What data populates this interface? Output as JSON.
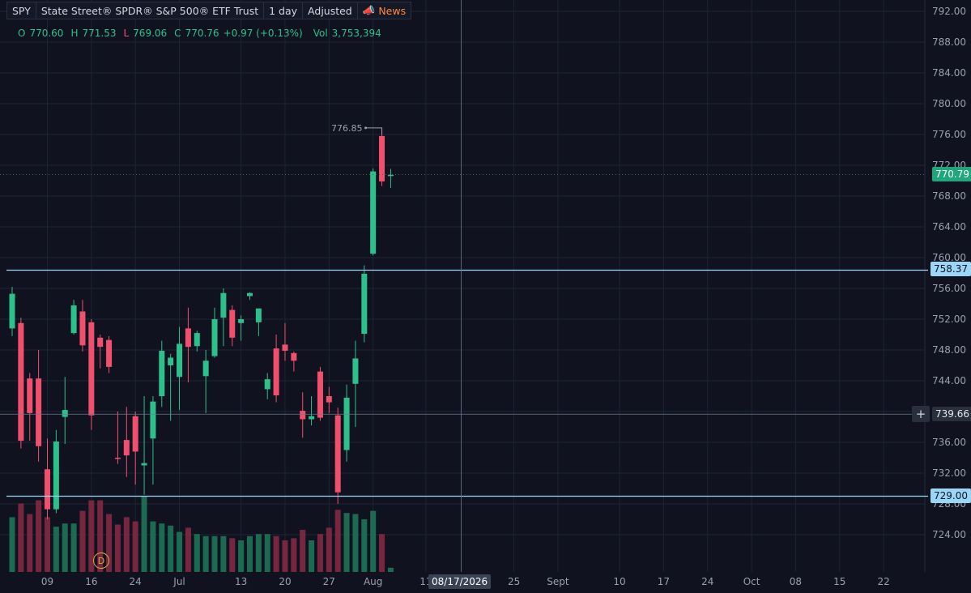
{
  "header": {
    "symbol": "SPY",
    "name": "State Street® SPDR® S&P 500® ETF Trust",
    "interval": "1 day",
    "adjusted": "Adjusted",
    "news": "News"
  },
  "ohlc": {
    "o_label": "O",
    "o": "770.60",
    "h_label": "H",
    "h": "771.53",
    "l_label": "L",
    "l": "769.06",
    "c_label": "C",
    "c": "770.76",
    "change": "+0.97 (+0.13%)",
    "vol_label": "Vol",
    "vol": "3,753,394"
  },
  "badges": {
    "current": "770.79",
    "level1": "758.37",
    "crosshair": "739.66",
    "level2": "729.00"
  },
  "high_marker": "776.85",
  "crosshair_date": "08/17/2026",
  "event_marker": "D",
  "colors": {
    "up": "#2ec08b",
    "down": "#f0506e",
    "level": "#9ad6f5",
    "background": "#10131f"
  },
  "chart_data": {
    "type": "candlestick",
    "y_ticks": [
      "792.00",
      "788.00",
      "784.00",
      "780.00",
      "776.00",
      "772.00",
      "768.00",
      "764.00",
      "760.00",
      "756.00",
      "752.00",
      "748.00",
      "744.00",
      "740.00",
      "736.00",
      "732.00",
      "728.00",
      "724.00"
    ],
    "x_ticks": [
      {
        "label": "09",
        "i": 4
      },
      {
        "label": "16",
        "i": 9
      },
      {
        "label": "24",
        "i": 14
      },
      {
        "label": "Jul",
        "i": 19
      },
      {
        "label": "13",
        "i": 26
      },
      {
        "label": "20",
        "i": 31
      },
      {
        "label": "27",
        "i": 36
      },
      {
        "label": "Aug",
        "i": 41
      },
      {
        "label": "11",
        "i": 47
      },
      {
        "label": "25",
        "i": 57
      },
      {
        "label": "Sept",
        "i": 62
      },
      {
        "label": "10",
        "i": 69
      },
      {
        "label": "17",
        "i": 74
      },
      {
        "label": "24",
        "i": 79
      },
      {
        "label": "Oct",
        "i": 84
      },
      {
        "label": "08",
        "i": 89
      },
      {
        "label": "15",
        "i": 94
      },
      {
        "label": "22",
        "i": 99
      }
    ],
    "ylim": [
      721.0,
      793.0
    ],
    "crosshair": {
      "i": 51,
      "y": 739.66
    },
    "levels": [
      758.37,
      729.0
    ],
    "candles": [
      {
        "o": 750.8,
        "h": 756.2,
        "l": 749.8,
        "c": 755.3,
        "v": 0.52
      },
      {
        "o": 751.5,
        "h": 752.2,
        "l": 735.2,
        "c": 736.2,
        "v": 0.65
      },
      {
        "o": 744.3,
        "h": 745.0,
        "l": 736.2,
        "c": 739.8,
        "v": 0.55
      },
      {
        "o": 744.3,
        "h": 748.0,
        "l": 733.5,
        "c": 735.5,
        "v": 0.68
      },
      {
        "o": 732.5,
        "h": 736.5,
        "l": 726.0,
        "c": 727.3,
        "v": 0.52
      },
      {
        "o": 727.3,
        "h": 737.6,
        "l": 726.8,
        "c": 736.1,
        "v": 0.43
      },
      {
        "o": 739.3,
        "h": 744.5,
        "l": 735.8,
        "c": 740.2,
        "v": 0.46
      },
      {
        "o": 750.2,
        "h": 754.5,
        "l": 750.0,
        "c": 753.8,
        "v": 0.46
      },
      {
        "o": 753.0,
        "h": 754.5,
        "l": 747.8,
        "c": 748.6,
        "v": 0.58
      },
      {
        "o": 751.6,
        "h": 752.0,
        "l": 737.6,
        "c": 739.5,
        "v": 0.68
      },
      {
        "o": 749.6,
        "h": 750.0,
        "l": 745.6,
        "c": 748.4,
        "v": 0.68
      },
      {
        "o": 749.3,
        "h": 749.8,
        "l": 745.0,
        "c": 745.8,
        "v": 0.55
      },
      {
        "o": 734.0,
        "h": 740.0,
        "l": 733.2,
        "c": 733.9,
        "v": 0.45
      },
      {
        "o": 736.3,
        "h": 740.6,
        "l": 731.5,
        "c": 734.3,
        "v": 0.52
      },
      {
        "o": 739.4,
        "h": 740.0,
        "l": 730.5,
        "c": 734.8,
        "v": 0.48
      },
      {
        "o": 733.0,
        "h": 742.0,
        "l": 729.2,
        "c": 733.3,
        "v": 0.72
      },
      {
        "o": 736.5,
        "h": 742.0,
        "l": 730.5,
        "c": 741.3,
        "v": 0.48
      },
      {
        "o": 742.0,
        "h": 749.2,
        "l": 740.6,
        "c": 747.9,
        "v": 0.46
      },
      {
        "o": 746.0,
        "h": 747.5,
        "l": 738.8,
        "c": 747.0,
        "v": 0.44
      },
      {
        "o": 744.5,
        "h": 751.0,
        "l": 740.2,
        "c": 748.8,
        "v": 0.38
      },
      {
        "o": 750.8,
        "h": 753.5,
        "l": 743.8,
        "c": 748.4,
        "v": 0.42
      },
      {
        "o": 748.5,
        "h": 750.5,
        "l": 747.8,
        "c": 750.2,
        "v": 0.36
      },
      {
        "o": 744.6,
        "h": 748.0,
        "l": 739.8,
        "c": 746.6,
        "v": 0.34
      },
      {
        "o": 747.2,
        "h": 753.5,
        "l": 747.0,
        "c": 752.0,
        "v": 0.34
      },
      {
        "o": 752.2,
        "h": 756.0,
        "l": 748.5,
        "c": 755.4,
        "v": 0.34
      },
      {
        "o": 753.2,
        "h": 753.8,
        "l": 748.5,
        "c": 749.6,
        "v": 0.32
      },
      {
        "o": 751.5,
        "h": 752.5,
        "l": 749.2,
        "c": 752.0,
        "v": 0.3
      },
      {
        "o": 755.0,
        "h": 755.5,
        "l": 754.5,
        "c": 755.4,
        "v": 0.34
      },
      {
        "o": 751.6,
        "h": 752.5,
        "l": 749.8,
        "c": 753.4,
        "v": 0.36
      },
      {
        "o": 742.9,
        "h": 745.0,
        "l": 741.6,
        "c": 744.2,
        "v": 0.36
      },
      {
        "o": 748.2,
        "h": 750.0,
        "l": 741.2,
        "c": 742.1,
        "v": 0.34
      },
      {
        "o": 748.7,
        "h": 751.5,
        "l": 746.6,
        "c": 747.9,
        "v": 0.3
      },
      {
        "o": 747.6,
        "h": 747.8,
        "l": 745.2,
        "c": 746.6,
        "v": 0.32
      },
      {
        "o": 740.1,
        "h": 742.5,
        "l": 736.6,
        "c": 739.0,
        "v": 0.4
      },
      {
        "o": 739.0,
        "h": 742.0,
        "l": 738.2,
        "c": 739.4,
        "v": 0.3
      },
      {
        "o": 745.2,
        "h": 745.8,
        "l": 738.8,
        "c": 739.2,
        "v": 0.36
      },
      {
        "o": 742.0,
        "h": 743.2,
        "l": 739.8,
        "c": 741.2,
        "v": 0.42
      },
      {
        "o": 739.5,
        "h": 740.5,
        "l": 728.0,
        "c": 729.5,
        "v": 0.59
      },
      {
        "o": 735.0,
        "h": 743.5,
        "l": 733.5,
        "c": 741.8,
        "v": 0.56
      },
      {
        "o": 743.6,
        "h": 749.2,
        "l": 738.0,
        "c": 746.9,
        "v": 0.55
      },
      {
        "o": 750.1,
        "h": 759.0,
        "l": 749.0,
        "c": 757.9,
        "v": 0.5
      },
      {
        "o": 760.5,
        "h": 771.6,
        "l": 760.3,
        "c": 771.2,
        "v": 0.58
      },
      {
        "o": 775.8,
        "h": 776.85,
        "l": 769.3,
        "c": 769.9,
        "v": 0.36
      },
      {
        "o": 770.6,
        "h": 771.53,
        "l": 769.06,
        "c": 770.76,
        "v": 0.04
      }
    ]
  }
}
